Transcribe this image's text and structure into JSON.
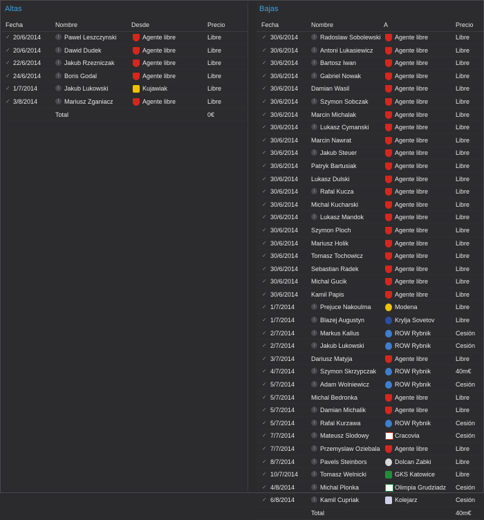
{
  "altas": {
    "title": "Altas",
    "headers": {
      "fecha": "Fecha",
      "nombre": "Nombre",
      "club": "Desde",
      "precio": "Precio"
    },
    "rows": [
      {
        "fecha": "20/6/2014",
        "nombre": "Pawel Leszczynski",
        "info": true,
        "club": "Agente libre",
        "badge": "libre",
        "precio": "Libre"
      },
      {
        "fecha": "20/6/2014",
        "nombre": "Dawid Dudek",
        "info": true,
        "club": "Agente libre",
        "badge": "libre",
        "precio": "Libre"
      },
      {
        "fecha": "22/6/2014",
        "nombre": "Jakub Rzezniczak",
        "info": true,
        "club": "Agente libre",
        "badge": "libre",
        "precio": "Libre"
      },
      {
        "fecha": "24/6/2014",
        "nombre": "Boris Godal",
        "info": true,
        "club": "Agente libre",
        "badge": "libre",
        "precio": "Libre"
      },
      {
        "fecha": "1/7/2014",
        "nombre": "Jakub Lukowski",
        "info": true,
        "club": "Kujawiak",
        "badge": "kujawiak",
        "precio": "Libre"
      },
      {
        "fecha": "3/8/2014",
        "nombre": "Mariusz Zganiacz",
        "info": true,
        "club": "Agente libre",
        "badge": "libre",
        "precio": "Libre"
      }
    ],
    "total_label": "Total",
    "total_value": "0€"
  },
  "bajas": {
    "title": "Bajas",
    "headers": {
      "fecha": "Fecha",
      "nombre": "Nombre",
      "club": "A",
      "precio": "Precio"
    },
    "rows": [
      {
        "fecha": "30/6/2014",
        "nombre": "Radoslaw Sobolewski",
        "info": true,
        "club": "Agente libre",
        "badge": "libre",
        "precio": "Libre"
      },
      {
        "fecha": "30/6/2014",
        "nombre": "Antoni Lukasiewicz",
        "info": true,
        "club": "Agente libre",
        "badge": "libre",
        "precio": "Libre"
      },
      {
        "fecha": "30/6/2014",
        "nombre": "Bartosz Iwan",
        "info": true,
        "club": "Agente libre",
        "badge": "libre",
        "precio": "Libre"
      },
      {
        "fecha": "30/6/2014",
        "nombre": "Gabriel Nowak",
        "info": true,
        "club": "Agente libre",
        "badge": "libre",
        "precio": "Libre"
      },
      {
        "fecha": "30/6/2014",
        "nombre": "Damian Wasil",
        "info": false,
        "club": "Agente libre",
        "badge": "libre",
        "precio": "Libre"
      },
      {
        "fecha": "30/6/2014",
        "nombre": "Szymon Sobczak",
        "info": true,
        "club": "Agente libre",
        "badge": "libre",
        "precio": "Libre"
      },
      {
        "fecha": "30/6/2014",
        "nombre": "Marcin Michalak",
        "info": false,
        "club": "Agente libre",
        "badge": "libre",
        "precio": "Libre"
      },
      {
        "fecha": "30/6/2014",
        "nombre": "Lukasz Cymanski",
        "info": true,
        "club": "Agente libre",
        "badge": "libre",
        "precio": "Libre"
      },
      {
        "fecha": "30/6/2014",
        "nombre": "Marcin Nawrat",
        "info": false,
        "club": "Agente libre",
        "badge": "libre",
        "precio": "Libre"
      },
      {
        "fecha": "30/6/2014",
        "nombre": "Jakub Steuer",
        "info": true,
        "club": "Agente libre",
        "badge": "libre",
        "precio": "Libre"
      },
      {
        "fecha": "30/6/2014",
        "nombre": "Patryk Bartusiak",
        "info": false,
        "club": "Agente libre",
        "badge": "libre",
        "precio": "Libre"
      },
      {
        "fecha": "30/6/2014",
        "nombre": "Lukasz Dulski",
        "info": false,
        "club": "Agente libre",
        "badge": "libre",
        "precio": "Libre"
      },
      {
        "fecha": "30/6/2014",
        "nombre": "Rafal Kucza",
        "info": true,
        "club": "Agente libre",
        "badge": "libre",
        "precio": "Libre"
      },
      {
        "fecha": "30/6/2014",
        "nombre": "Michal Kucharski",
        "info": false,
        "club": "Agente libre",
        "badge": "libre",
        "precio": "Libre"
      },
      {
        "fecha": "30/6/2014",
        "nombre": "Lukasz Mandok",
        "info": true,
        "club": "Agente libre",
        "badge": "libre",
        "precio": "Libre"
      },
      {
        "fecha": "30/6/2014",
        "nombre": "Szymon Ploch",
        "info": false,
        "club": "Agente libre",
        "badge": "libre",
        "precio": "Libre"
      },
      {
        "fecha": "30/6/2014",
        "nombre": "Mariusz Holik",
        "info": false,
        "club": "Agente libre",
        "badge": "libre",
        "precio": "Libre"
      },
      {
        "fecha": "30/6/2014",
        "nombre": "Tomasz Tochowicz",
        "info": false,
        "club": "Agente libre",
        "badge": "libre",
        "precio": "Libre"
      },
      {
        "fecha": "30/6/2014",
        "nombre": "Sebastian Radek",
        "info": false,
        "club": "Agente libre",
        "badge": "libre",
        "precio": "Libre"
      },
      {
        "fecha": "30/6/2014",
        "nombre": "Michal Gucik",
        "info": false,
        "club": "Agente libre",
        "badge": "libre",
        "precio": "Libre"
      },
      {
        "fecha": "30/6/2014",
        "nombre": "Kamil Papis",
        "info": false,
        "club": "Agente libre",
        "badge": "libre",
        "precio": "Libre"
      },
      {
        "fecha": "1/7/2014",
        "nombre": "Prejuce Nakoulma",
        "info": true,
        "club": "Modena",
        "badge": "modena",
        "precio": "Libre"
      },
      {
        "fecha": "1/7/2014",
        "nombre": "Blazej Augustyn",
        "info": true,
        "club": "Krylja Sovetov",
        "badge": "krylja",
        "precio": "Libre"
      },
      {
        "fecha": "2/7/2014",
        "nombre": "Markus Kallus",
        "info": true,
        "club": "ROW Rybnik",
        "badge": "row",
        "precio": "Cesión"
      },
      {
        "fecha": "2/7/2014",
        "nombre": "Jakub Lukowski",
        "info": true,
        "club": "ROW Rybnik",
        "badge": "row",
        "precio": "Cesión"
      },
      {
        "fecha": "3/7/2014",
        "nombre": "Dariusz Matyja",
        "info": false,
        "club": "Agente libre",
        "badge": "libre",
        "precio": "Libre"
      },
      {
        "fecha": "4/7/2014",
        "nombre": "Szymon Skrzypczak",
        "info": true,
        "club": "ROW Rybnik",
        "badge": "row",
        "precio": "40m€"
      },
      {
        "fecha": "5/7/2014",
        "nombre": "Adam Wolniewicz",
        "info": true,
        "club": "ROW Rybnik",
        "badge": "row",
        "precio": "Cesión"
      },
      {
        "fecha": "5/7/2014",
        "nombre": "Michal Bedronka",
        "info": false,
        "club": "Agente libre",
        "badge": "libre",
        "precio": "Libre"
      },
      {
        "fecha": "5/7/2014",
        "nombre": "Damian Michalik",
        "info": true,
        "club": "Agente libre",
        "badge": "libre",
        "precio": "Libre"
      },
      {
        "fecha": "5/7/2014",
        "nombre": "Rafal Kurzawa",
        "info": true,
        "club": "ROW Rybnik",
        "badge": "row",
        "precio": "Cesión"
      },
      {
        "fecha": "7/7/2014",
        "nombre": "Mateusz Slodowy",
        "info": true,
        "club": "Cracovia",
        "badge": "cracovia",
        "precio": "Cesión"
      },
      {
        "fecha": "7/7/2014",
        "nombre": "Przemyslaw Oziebala",
        "info": true,
        "club": "Agente libre",
        "badge": "libre",
        "precio": "Libre"
      },
      {
        "fecha": "8/7/2014",
        "nombre": "Pavels Steinbors",
        "info": true,
        "club": "Dolcan Zabki",
        "badge": "dolcan",
        "precio": "Libre"
      },
      {
        "fecha": "10/7/2014",
        "nombre": "Tomasz Welnicki",
        "info": true,
        "club": "GKS Katowice",
        "badge": "gks",
        "precio": "Libre"
      },
      {
        "fecha": "4/8/2014",
        "nombre": "Michal Plonka",
        "info": true,
        "club": "Olimpia Grudziadz",
        "badge": "olimpia",
        "precio": "Cesión"
      },
      {
        "fecha": "6/8/2014",
        "nombre": "Kamil Cupriak",
        "info": true,
        "club": "Kolejarz",
        "badge": "kolejarz",
        "precio": "Cesión"
      }
    ],
    "total_label": "Total",
    "total_value": "40m€"
  }
}
